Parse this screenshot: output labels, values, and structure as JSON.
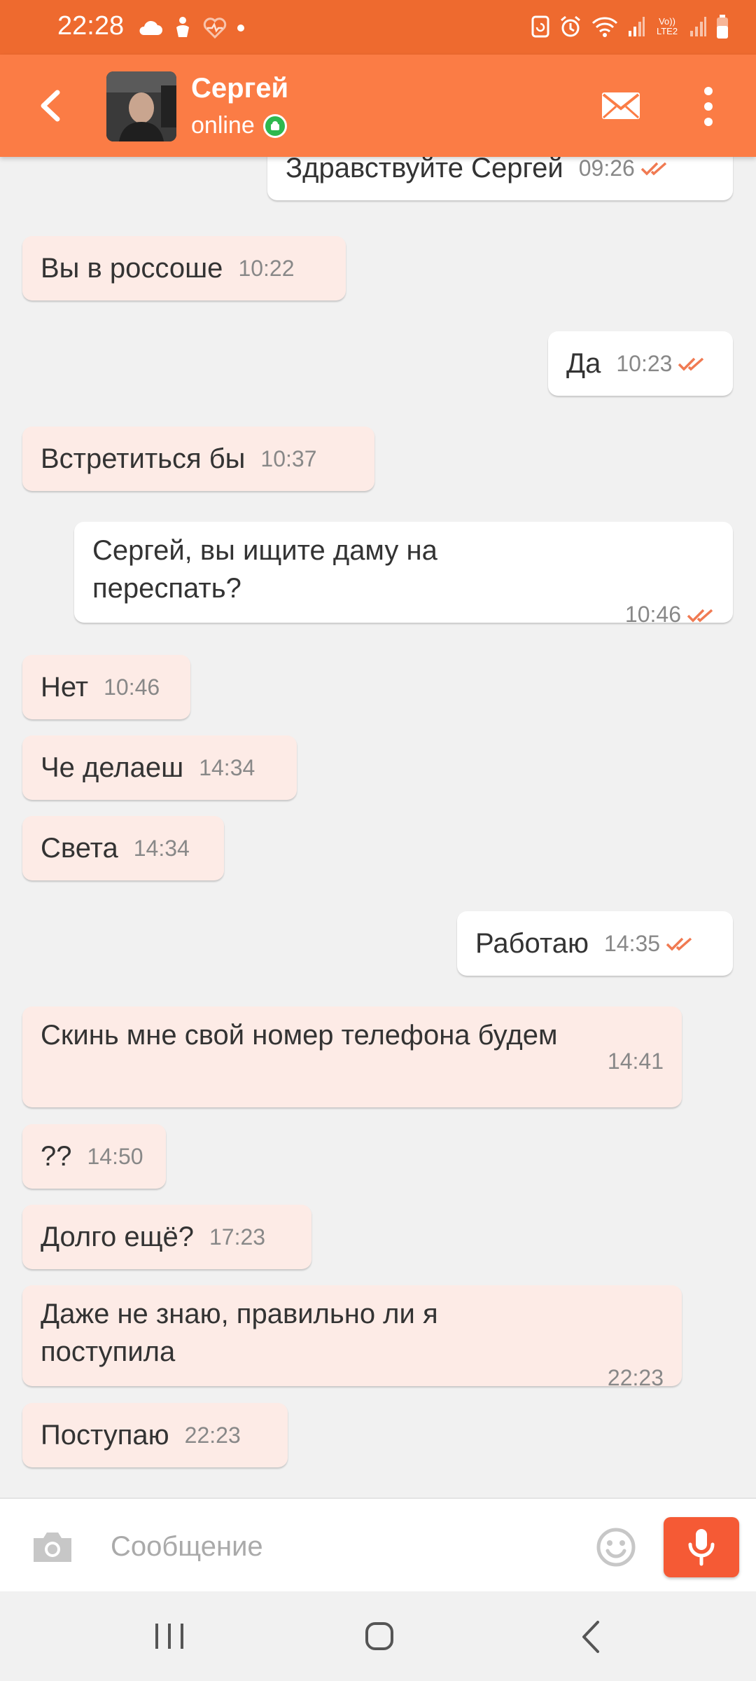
{
  "status_bar": {
    "time": "22:28",
    "left_icons": [
      "cloud-icon",
      "hand-icon",
      "heart-rate-icon",
      "dot-icon"
    ],
    "right_icons": [
      "rotate-icon",
      "alarm-icon",
      "wifi-icon",
      "signal-icon",
      "volte-lte2-icon",
      "signal-icon",
      "battery-icon"
    ],
    "network_label": "Vo)) LTE2"
  },
  "header": {
    "contact_name": "Сергей",
    "status": "online",
    "accent_color": "#fb7c45",
    "online_color": "#2eb84e"
  },
  "messages": [
    {
      "direction": "out",
      "text": "Здравствуйте Сергей",
      "time": "09:26",
      "read": true
    },
    {
      "direction": "in",
      "text": "Вы в россоше",
      "time": "10:22"
    },
    {
      "direction": "out",
      "text": "Да",
      "time": "10:23",
      "read": true
    },
    {
      "direction": "in",
      "text": "Встретиться бы",
      "time": "10:37"
    },
    {
      "direction": "out",
      "text": "Сергей, вы ищите даму на переспать?",
      "time": "10:46",
      "read": true
    },
    {
      "direction": "in",
      "text": "Нет",
      "time": "10:46"
    },
    {
      "direction": "in",
      "text": "Че делаеш",
      "time": "14:34"
    },
    {
      "direction": "in",
      "text": "Света",
      "time": "14:34"
    },
    {
      "direction": "out",
      "text": "Работаю",
      "time": "14:35",
      "read": true
    },
    {
      "direction": "in",
      "text": "Скинь мне свой номер телефона будем",
      "time": "14:41"
    },
    {
      "direction": "in",
      "text": "??",
      "time": "14:50"
    },
    {
      "direction": "in",
      "text": "Долго ещё?",
      "time": "17:23"
    },
    {
      "direction": "in",
      "text": "Даже не знаю, правильно ли я поступила",
      "time": "22:23"
    },
    {
      "direction": "in",
      "text": "Поступаю",
      "time": "22:23"
    }
  ],
  "input": {
    "placeholder": "Сообщение",
    "value": ""
  },
  "colors": {
    "status_bar": "#ee6a2f",
    "incoming_bubble": "#fdebe6",
    "outgoing_bubble": "#ffffff",
    "read_check": "#f07a52",
    "mic_button": "#f55a35"
  }
}
